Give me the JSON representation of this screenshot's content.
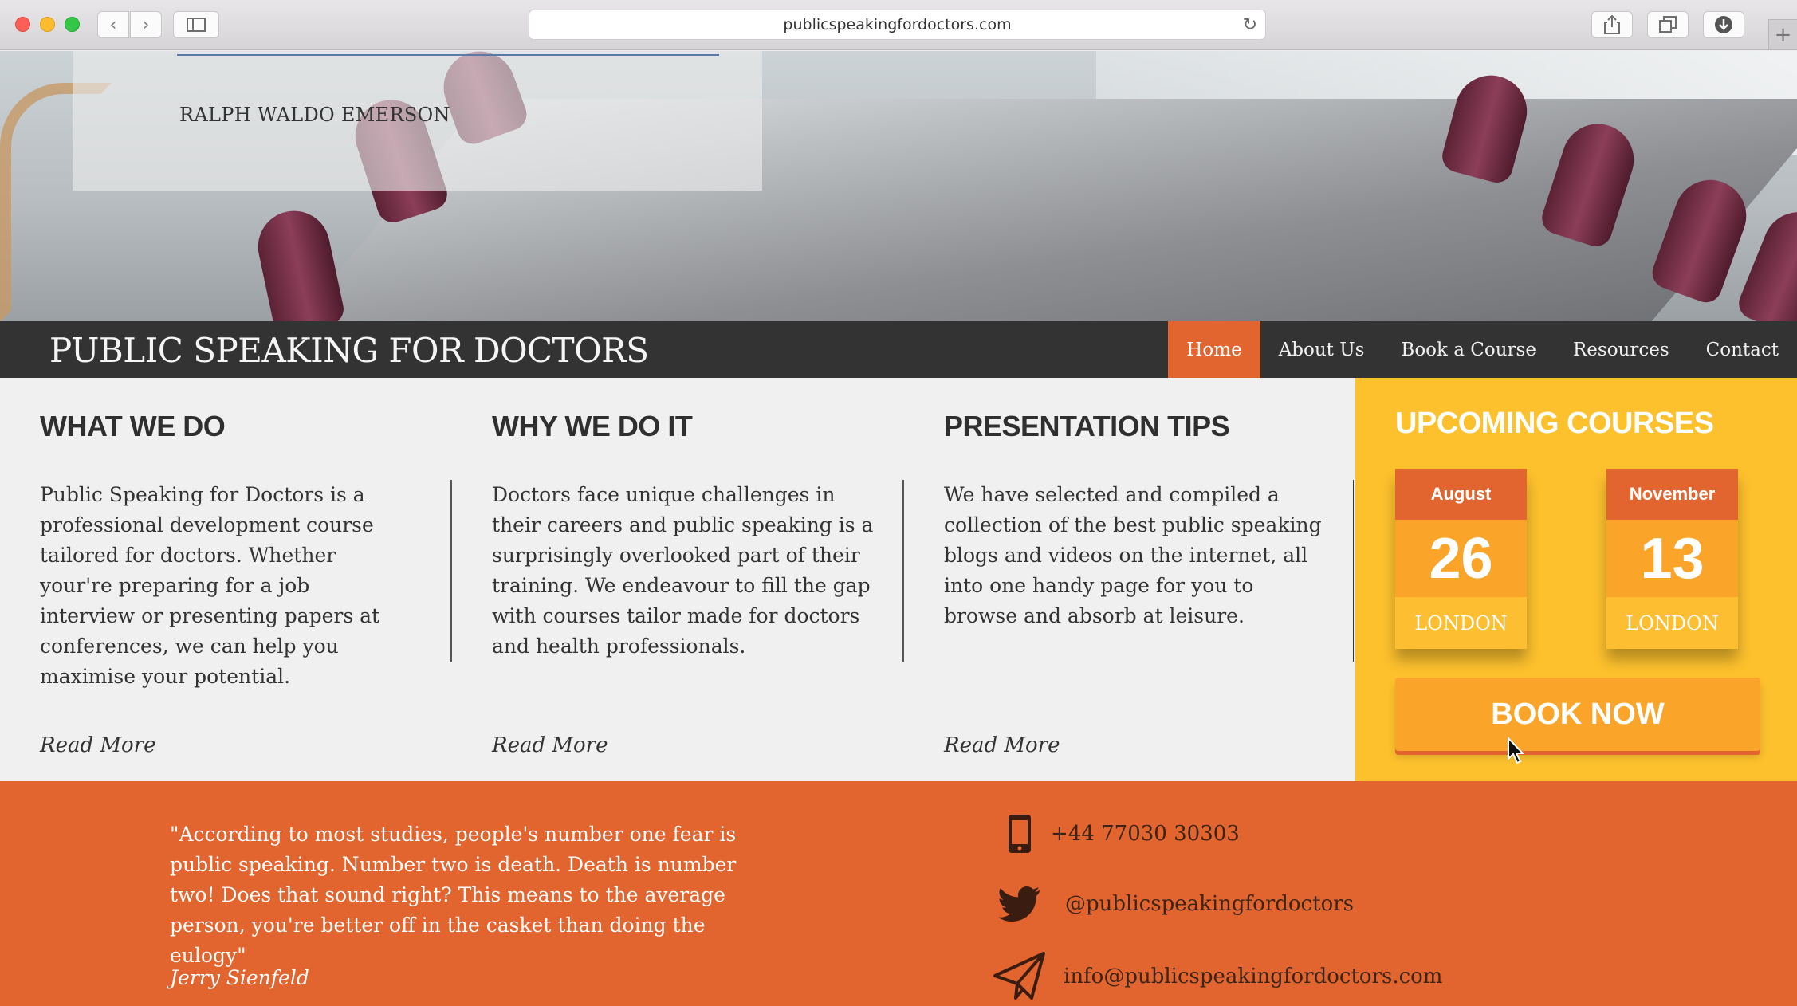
{
  "browser": {
    "url": "publicspeakingfordoctors.com",
    "icons": [
      "back-icon",
      "forward-icon",
      "sidebar-icon",
      "reload-icon",
      "share-icon",
      "tabs-icon",
      "download-icon",
      "new-tab-icon"
    ]
  },
  "hero": {
    "quote_author": "RALPH WALDO EMERSON"
  },
  "nav": {
    "site_title": "PUBLIC SPEAKING FOR DOCTORS",
    "items": [
      {
        "label": "Home",
        "active": true
      },
      {
        "label": "About Us",
        "active": false
      },
      {
        "label": "Book a Course",
        "active": false
      },
      {
        "label": "Resources",
        "active": false
      },
      {
        "label": "Contact",
        "active": false
      }
    ]
  },
  "columns": [
    {
      "heading": "WHAT WE DO",
      "body": "Public Speaking for Doctors is a professional development course tailored for doctors. Whether your're preparing for a job interview or presenting papers at conferences, we can help you maximise your potential.",
      "link": "Read More"
    },
    {
      "heading": "WHY WE DO IT",
      "body": "Doctors face unique challenges in their careers and public speaking is a surprisingly overlooked part of their training. We endeavour to fill the gap with courses tailor made for doctors and health professionals.",
      "link": "Read More"
    },
    {
      "heading": "PRESENTATION TIPS",
      "body": "We have selected and compiled a collection of the best public speaking blogs and videos on the internet, all into one handy page for you to browse and absorb at leisure.",
      "link": "Read More"
    }
  ],
  "courses": {
    "title": "UPCOMING COURSES",
    "items": [
      {
        "month": "August",
        "day": "26",
        "city": "LONDON"
      },
      {
        "month": "November",
        "day": "13",
        "city": "LONDON"
      }
    ],
    "book_button": "BOOK NOW"
  },
  "footer": {
    "quote": "\"According to most studies, people's number one fear is public speaking. Number two is death. Death is number two! Does that sound right? This means to the average person, you're better off in the casket than doing the eulogy\"",
    "quote_author": "Jerry Sienfeld",
    "phone": "+44 77030 30303",
    "twitter": "@publicspeakingfordoctors",
    "email": "info@publicspeakingfordoctors.com"
  },
  "colors": {
    "accent_orange": "#e2652f",
    "yellow": "#fdc12d",
    "nav_dark": "#333333",
    "content_bg": "#f0f0f0"
  }
}
